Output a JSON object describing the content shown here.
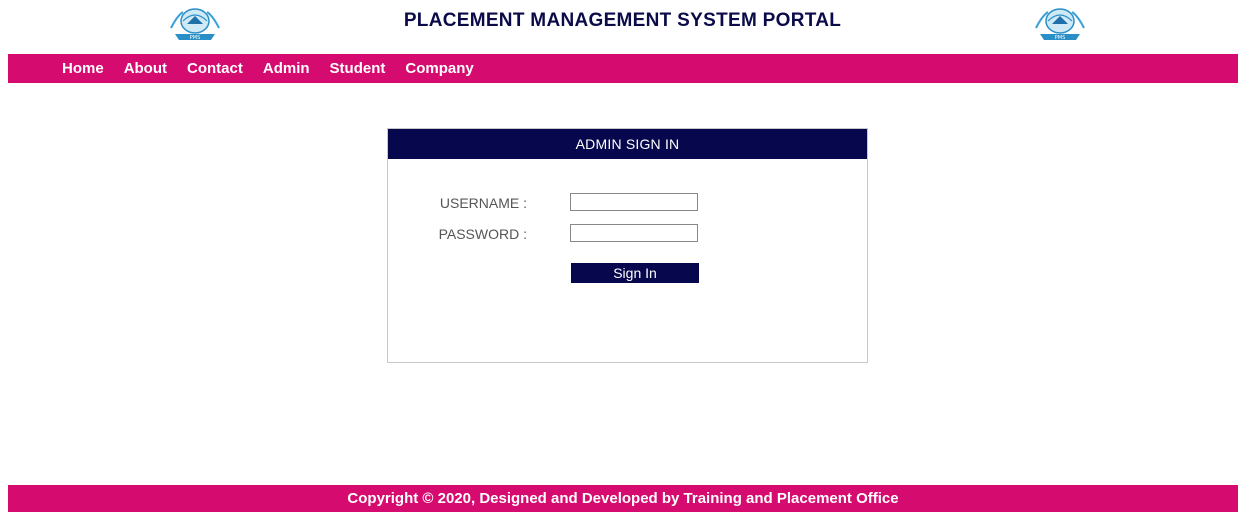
{
  "header": {
    "title": "PLACEMENT MANAGEMENT SYSTEM PORTAL",
    "logo_text": "PMS"
  },
  "nav": {
    "items": [
      {
        "label": "Home"
      },
      {
        "label": "About"
      },
      {
        "label": "Contact"
      },
      {
        "label": "Admin"
      },
      {
        "label": "Student"
      },
      {
        "label": "Company"
      }
    ]
  },
  "login": {
    "heading": "ADMIN SIGN IN",
    "username_label": "USERNAME :",
    "username_value": "",
    "password_label": "PASSWORD :",
    "password_value": "",
    "submit_label": "Sign In"
  },
  "footer": {
    "text": "Copyright © 2020, Designed and Developed by Training and Placement Office"
  },
  "colors": {
    "accent": "#d60b6f",
    "navy": "#07074d"
  },
  "icons": {
    "logo": "pms-crest-logo"
  }
}
